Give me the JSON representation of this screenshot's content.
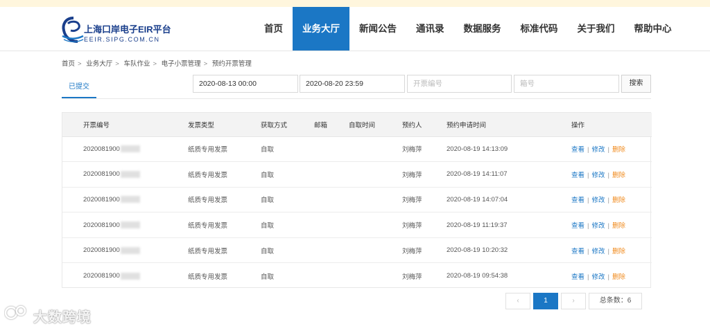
{
  "logo": {
    "name_cn": "上海口岸电子EIR平台",
    "domain": "EEIR.SIPG.COM.CN"
  },
  "nav": [
    {
      "label": "首页",
      "active": false
    },
    {
      "label": "业务大厅",
      "active": true
    },
    {
      "label": "新闻公告",
      "active": false
    },
    {
      "label": "通讯录",
      "active": false
    },
    {
      "label": "数据服务",
      "active": false
    },
    {
      "label": "标准代码",
      "active": false
    },
    {
      "label": "关于我们",
      "active": false
    },
    {
      "label": "帮助中心",
      "active": false
    }
  ],
  "breadcrumb": [
    "首页",
    "业务大厅",
    "车队作业",
    "电子小票管理",
    "预约开票管理"
  ],
  "tab": {
    "label": "已提交"
  },
  "filters": {
    "start_date": "2020-08-13 00:00",
    "end_date": "2020-08-20 23:59",
    "invoice_no_placeholder": "开票编号",
    "box_no_placeholder": "箱号",
    "search_label": "搜索"
  },
  "table": {
    "headers": [
      "开票编号",
      "发票类型",
      "获取方式",
      "邮箱",
      "自取时间",
      "预约人",
      "预约申请时间",
      "操作"
    ],
    "rows": [
      {
        "invoice_no": "2020081900",
        "invoice_type": "纸质专用发票",
        "method": "自取",
        "email": "",
        "pickup_time": "",
        "person": "刘梅萍",
        "apply_time": "2020-08-19 14:13:09"
      },
      {
        "invoice_no": "2020081900",
        "invoice_type": "纸质专用发票",
        "method": "自取",
        "email": "",
        "pickup_time": "",
        "person": "刘梅萍",
        "apply_time": "2020-08-19 14:11:07"
      },
      {
        "invoice_no": "2020081900",
        "invoice_type": "纸质专用发票",
        "method": "自取",
        "email": "",
        "pickup_time": "",
        "person": "刘梅萍",
        "apply_time": "2020-08-19 14:07:04"
      },
      {
        "invoice_no": "2020081900",
        "invoice_type": "纸质专用发票",
        "method": "自取",
        "email": "",
        "pickup_time": "",
        "person": "刘梅萍",
        "apply_time": "2020-08-19 11:19:37"
      },
      {
        "invoice_no": "2020081900",
        "invoice_type": "纸质专用发票",
        "method": "自取",
        "email": "",
        "pickup_time": "",
        "person": "刘梅萍",
        "apply_time": "2020-08-19 10:20:32"
      },
      {
        "invoice_no": "2020081900",
        "invoice_type": "纸质专用发票",
        "method": "自取",
        "email": "",
        "pickup_time": "",
        "person": "刘梅萍",
        "apply_time": "2020-08-19 09:54:38"
      }
    ],
    "actions": {
      "view": "查看",
      "edit": "修改",
      "delete": "删除",
      "separator": "|"
    }
  },
  "pagination": {
    "prev": "‹",
    "current": "1",
    "next": "›",
    "total": "总条数：6"
  },
  "watermark": {
    "text": "大数跨境"
  }
}
